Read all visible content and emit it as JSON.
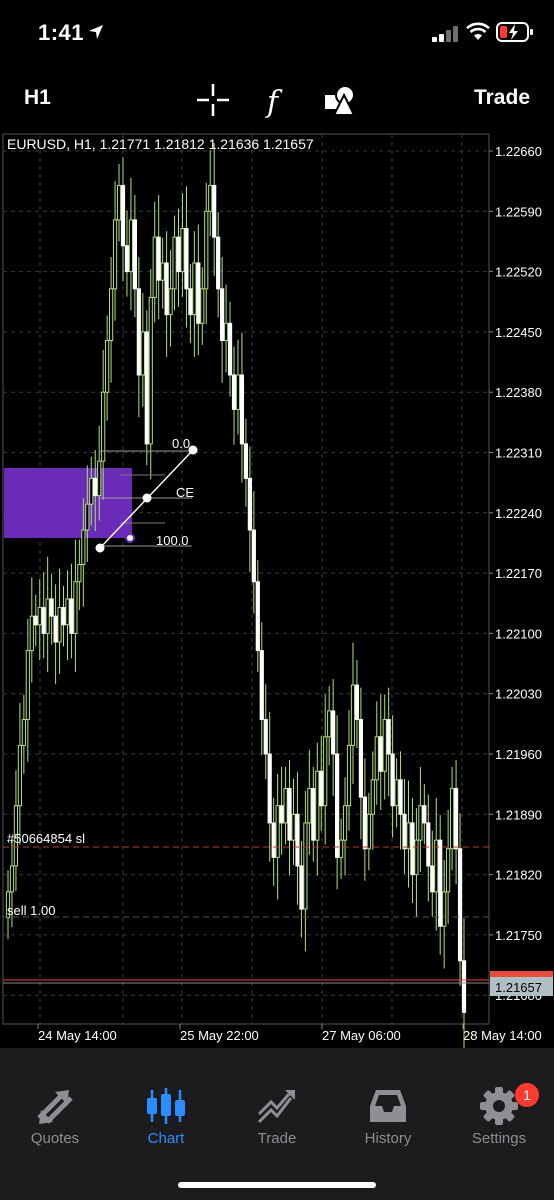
{
  "status": {
    "time": "1:41"
  },
  "toolbar": {
    "timeframe": "H1",
    "trade_label": "Trade"
  },
  "chart": {
    "title": "EURUSD, H1, 1.21771 1.21812 1.21636 1.21657",
    "price_ticks": [
      "1.22660",
      "1.22590",
      "1.22520",
      "1.22450",
      "1.22380",
      "1.22310",
      "1.22240",
      "1.22170",
      "1.22100",
      "1.22030",
      "1.21960",
      "1.21890",
      "1.21820",
      "1.21750",
      "1.21680"
    ],
    "current_price": "1.21657",
    "time_ticks": [
      "24 May 14:00",
      "25 May 22:00",
      "27 May 06:00",
      "28 May 14:00"
    ],
    "order_line_label": "#50664854 sl",
    "sell_label": "sell 1.00",
    "fib_levels": [
      "0.0",
      "CE",
      "100.0"
    ],
    "colors": {
      "bull_candle": "#b0e07a",
      "zone": "#6a2bb8",
      "sl_line": "#c0392b",
      "bid_line": "#e74c3c"
    }
  },
  "tabs": [
    {
      "label": "Quotes",
      "icon": "quotes-arrows-icon"
    },
    {
      "label": "Chart",
      "icon": "candlestick-chart-icon",
      "active": true
    },
    {
      "label": "Trade",
      "icon": "trade-trend-icon"
    },
    {
      "label": "History",
      "icon": "history-inbox-icon"
    },
    {
      "label": "Settings",
      "icon": "settings-gear-icon",
      "badge": "1"
    }
  ]
}
